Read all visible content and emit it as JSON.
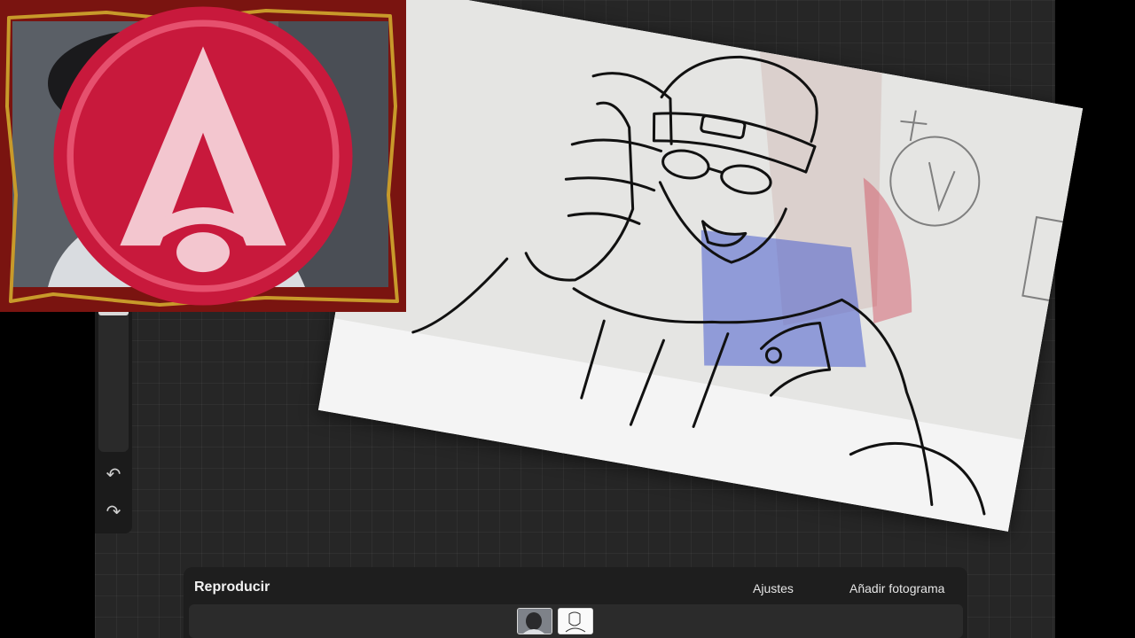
{
  "animation_bar": {
    "title": "Reproducir",
    "settings_label": "Ajustes",
    "add_frame_label": "Añadir fotograma"
  },
  "side_toolbar": {
    "undo_icon": "undo-icon",
    "redo_icon": "redo-icon"
  },
  "frames": [
    {
      "name": "frame-1",
      "kind": "webcam-photo"
    },
    {
      "name": "frame-2",
      "kind": "sketch"
    }
  ],
  "colors": {
    "workspace": "#262626",
    "webcam_border": "#7a1410",
    "logo": "#c8193c",
    "text": "#e6e6e6"
  }
}
